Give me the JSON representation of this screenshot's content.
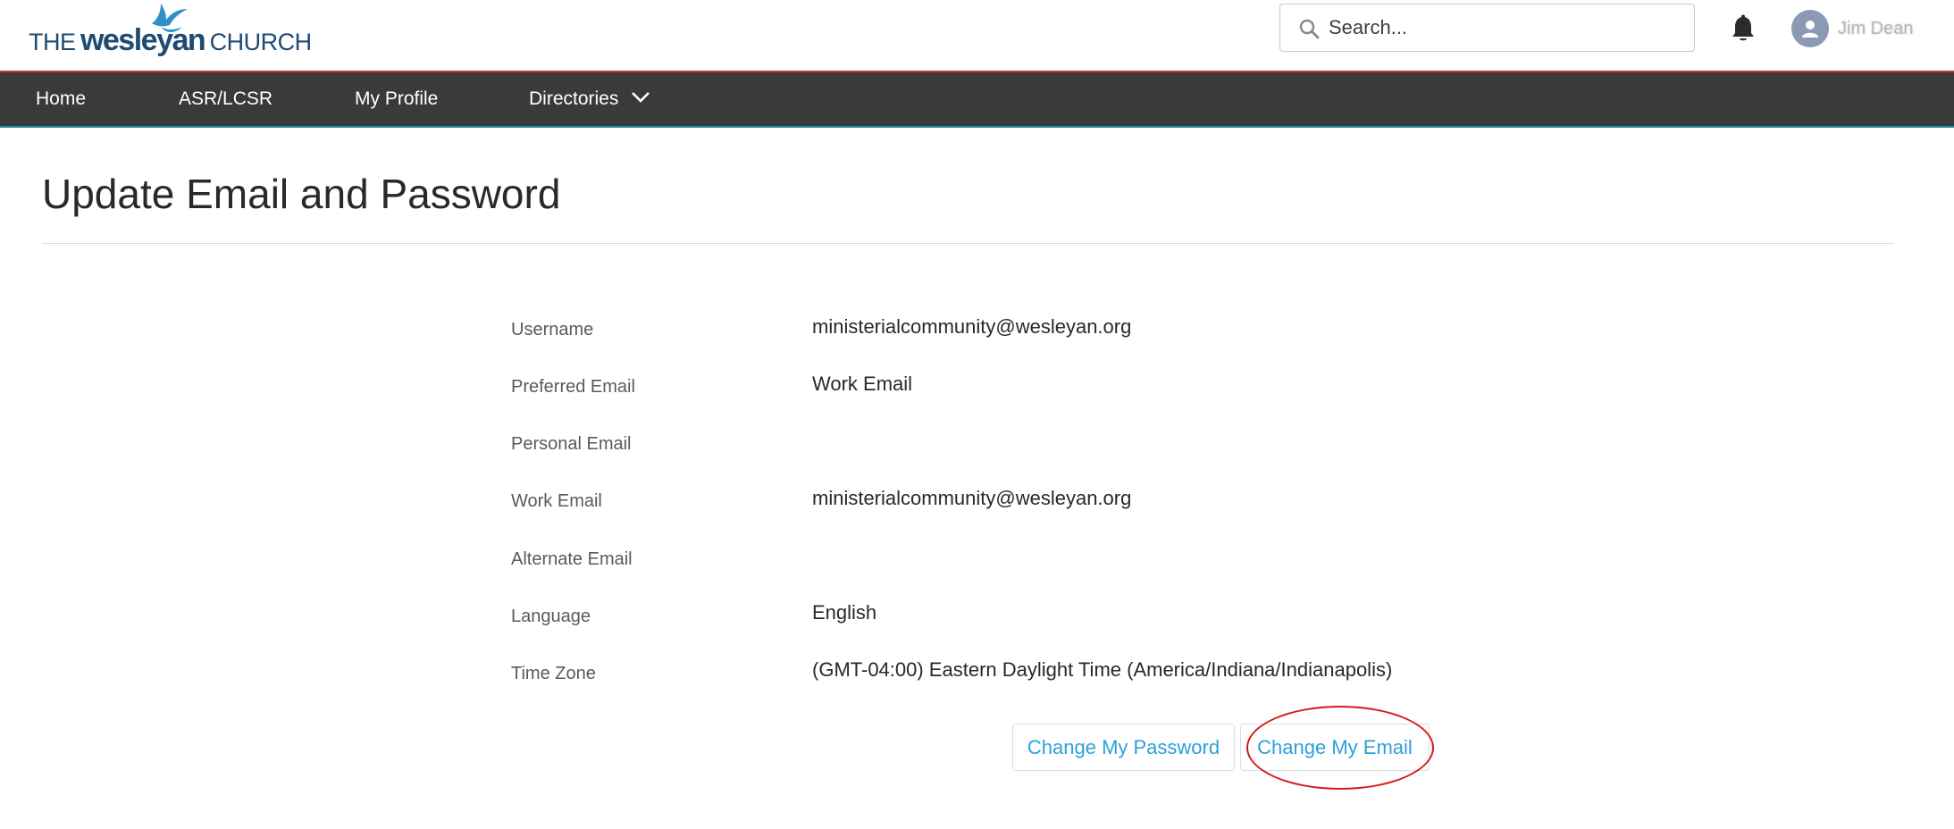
{
  "logo": {
    "the": "THE",
    "wesleyan": "wesleyan",
    "church": "CHURCH"
  },
  "search": {
    "placeholder": "Search..."
  },
  "user": {
    "name": "Jim Dean"
  },
  "nav": {
    "home": "Home",
    "asr": "ASR/LCSR",
    "profile": "My Profile",
    "directories": "Directories"
  },
  "page": {
    "title": "Update Email and Password"
  },
  "fields": [
    {
      "label": "Username",
      "value": "ministerialcommunity@wesleyan.org"
    },
    {
      "label": "Preferred Email",
      "value": "Work Email"
    },
    {
      "label": "Personal Email",
      "value": ""
    },
    {
      "label": "Work Email",
      "value": "ministerialcommunity@wesleyan.org"
    },
    {
      "label": "Alternate Email",
      "value": ""
    },
    {
      "label": "Language",
      "value": "English"
    },
    {
      "label": "Time Zone",
      "value": "(GMT-04:00) Eastern Daylight Time (America/Indiana/Indianapolis)"
    }
  ],
  "buttons": {
    "change_password": "Change My Password",
    "change_email": "Change My Email"
  },
  "colors": {
    "nav_bg": "#3a3a3a",
    "brand": "#1f4b73",
    "link": "#2da0d9",
    "highlight": "#d7191c"
  },
  "icons": {
    "search": "search-icon",
    "bell": "bell-icon",
    "avatar": "user-avatar-icon",
    "chevron": "chevron-down-icon",
    "logo_mark": "dove-icon"
  }
}
